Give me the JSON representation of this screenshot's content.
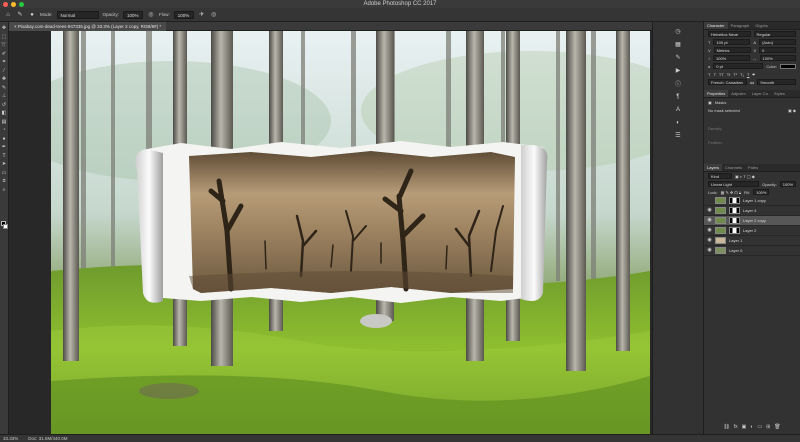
{
  "window": {
    "title": "Adobe Photoshop CC 2017",
    "traffic": [
      "#ff5f57",
      "#ffbd2e",
      "#28c840"
    ]
  },
  "options_bar": {
    "mode_label": "Mode:",
    "mode_value": "Normal",
    "opacity_label": "Opacity:",
    "opacity_value": "100%",
    "flow_label": "Flow:",
    "flow_value": "100%"
  },
  "document": {
    "tab_title": "Pixabay.com-dead-trees-947335.jpg @ 33.3% (Layer 2 copy, RGB/8#) *"
  },
  "character_panel": {
    "tabs": [
      "Character",
      "Paragraph",
      "Glyphs"
    ],
    "active_tab": "Character",
    "font_family": "Helvetica Neue",
    "font_style": "Regular",
    "size": "100 pt",
    "leading": "(Auto)",
    "kerning": "Metrics",
    "tracking": "0",
    "vertical_scale": "100%",
    "horizontal_scale": "100%",
    "baseline": "0 pt",
    "color_label": "Color:",
    "language": "French: Canadian",
    "anti_alias": "Smooth"
  },
  "properties_panel": {
    "tabs": [
      "Properties",
      "Adjustm",
      "Layer Co",
      "Styles"
    ],
    "active_tab": "Properties",
    "masks_label": "Masks",
    "no_mask": "No mask selected",
    "density_label": "Density:",
    "feather_label": "Feather:"
  },
  "layers_panel": {
    "tabs": [
      "Layers",
      "Channels",
      "Paths"
    ],
    "active_tab": "Layers",
    "filter_kind": "Kind",
    "blend_mode": "Linear Light",
    "opacity_label": "Opacity:",
    "opacity_value": "100%",
    "lock_label": "Lock:",
    "fill_label": "Fill:",
    "fill_value": "100%",
    "layers": [
      {
        "name": "Layer 1 copy",
        "visible": false,
        "selected": false,
        "has_mask": true
      },
      {
        "name": "Layer 4",
        "visible": true,
        "selected": false,
        "has_mask": true
      },
      {
        "name": "Layer 2 copy",
        "visible": true,
        "selected": true,
        "has_mask": true
      },
      {
        "name": "Layer 2",
        "visible": true,
        "selected": false,
        "has_mask": true
      },
      {
        "name": "Layer 1",
        "visible": true,
        "selected": false,
        "has_mask": false
      },
      {
        "name": "Layer 0",
        "visible": true,
        "selected": false,
        "has_mask": false
      }
    ]
  },
  "status": {
    "zoom": "33.33%",
    "doc_size": "Doc: 31.6M/440.0M"
  },
  "icons": {
    "tools": [
      "move-icon",
      "marquee-icon",
      "lasso-icon",
      "quick-select-icon",
      "crop-icon",
      "eyedropper-icon",
      "healing-icon",
      "brush-icon",
      "stamp-icon",
      "history-brush-icon",
      "eraser-icon",
      "gradient-icon",
      "blur-icon",
      "dodge-icon",
      "pen-icon",
      "type-icon",
      "path-select-icon",
      "shape-icon",
      "hand-icon",
      "zoom-icon"
    ]
  }
}
